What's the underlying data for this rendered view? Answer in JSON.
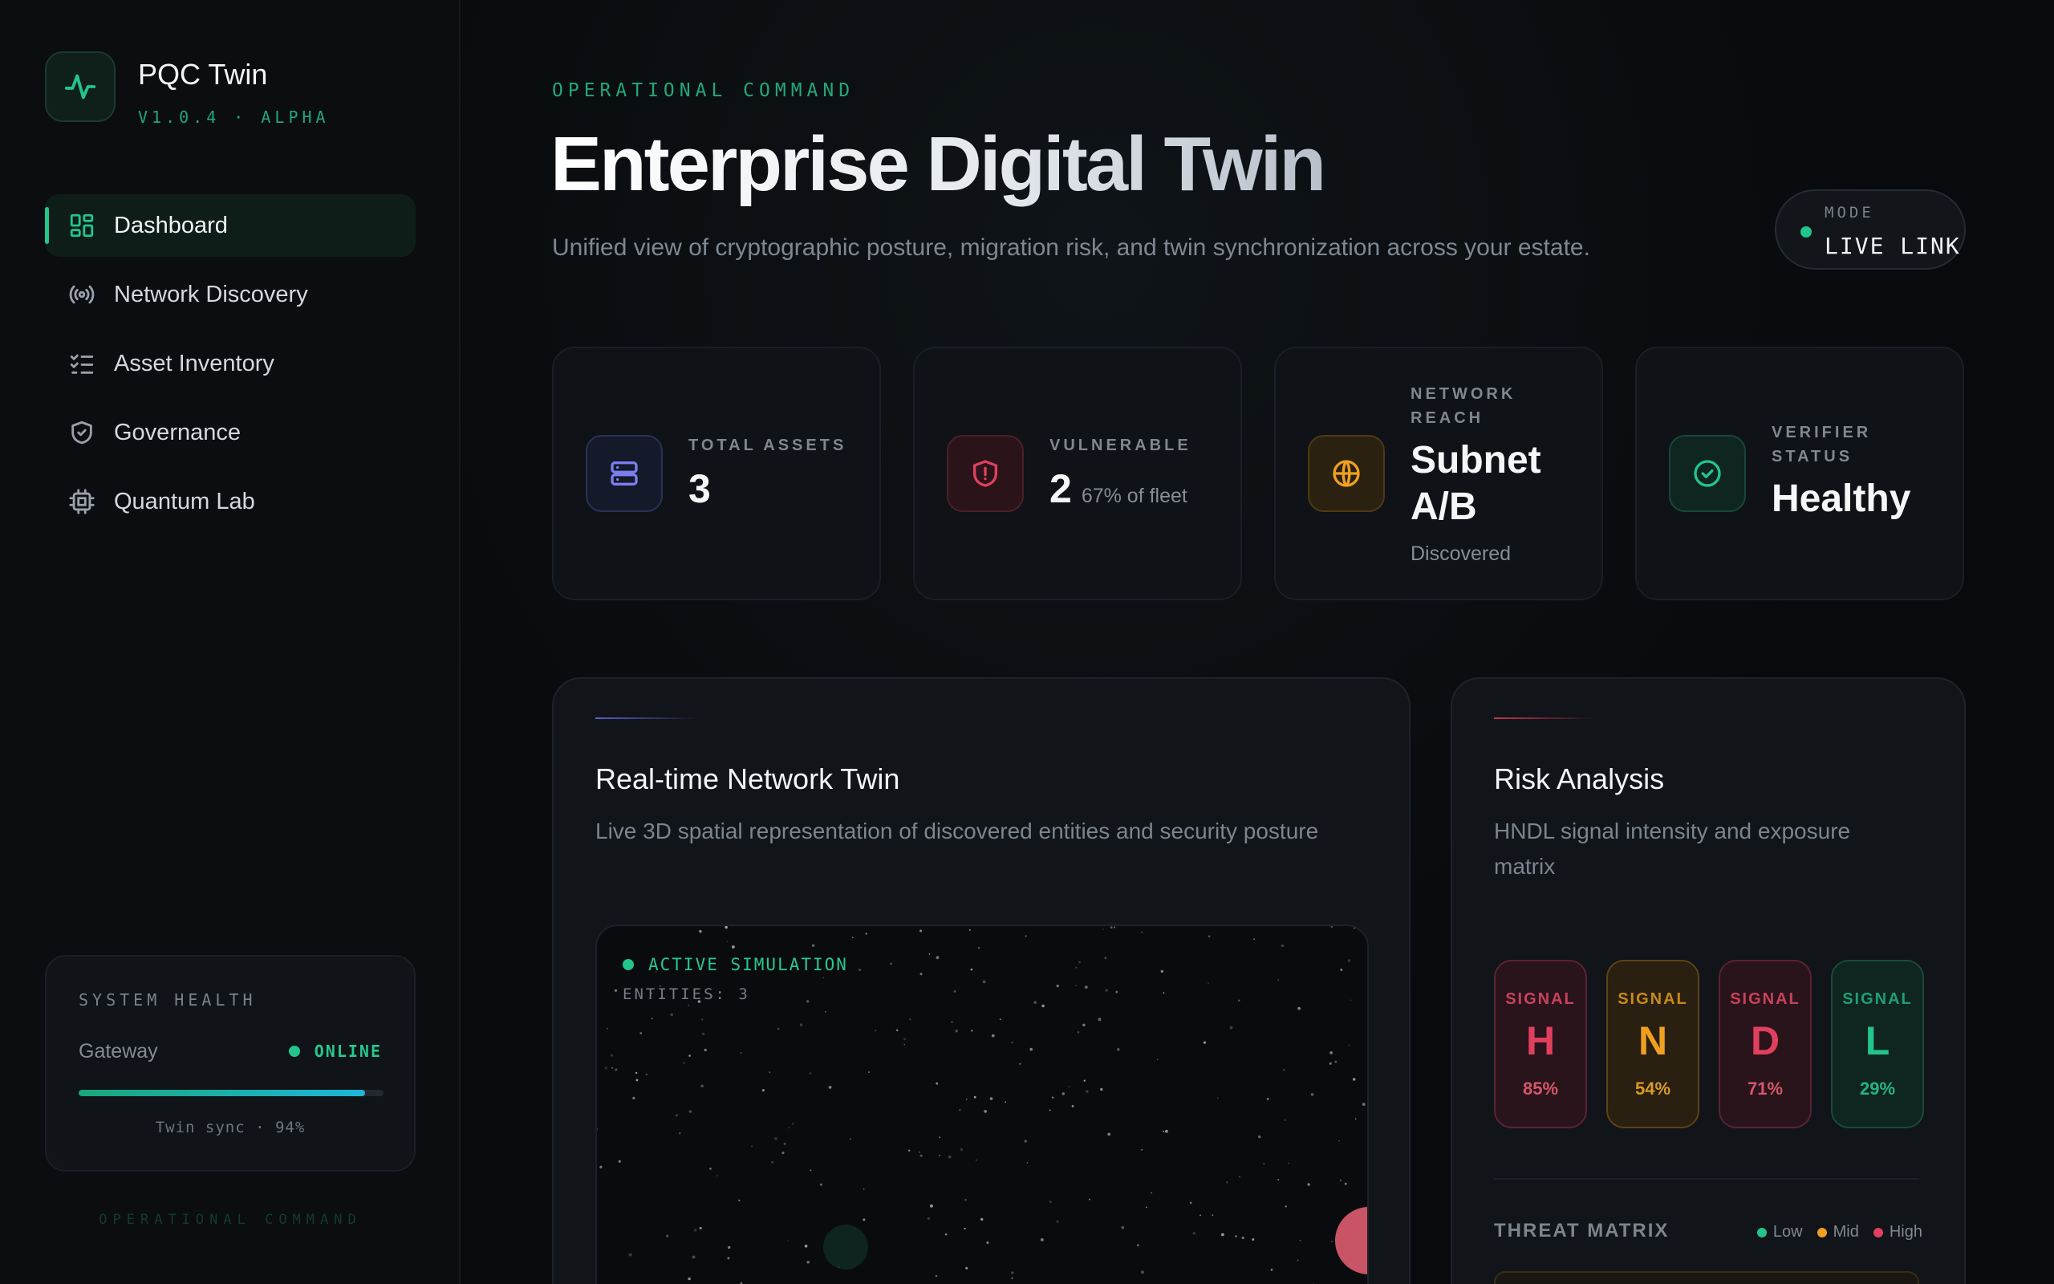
{
  "sidebar": {
    "app_title": "PQC Twin",
    "app_version": "V1.0.4 · ALPHA",
    "logo_icon": "activity-pulse-icon",
    "nav": [
      {
        "label": "Dashboard",
        "icon": "dashboard-grid-icon",
        "active": true
      },
      {
        "label": "Network Discovery",
        "icon": "broadcast-icon",
        "active": false
      },
      {
        "label": "Asset Inventory",
        "icon": "checklist-icon",
        "active": false
      },
      {
        "label": "Governance",
        "icon": "shield-check-icon",
        "active": false
      },
      {
        "label": "Quantum Lab",
        "icon": "cpu-chip-icon",
        "active": false
      }
    ],
    "health": {
      "title": "SYSTEM HEALTH",
      "label": "Gateway",
      "status": "ONLINE",
      "sync_text": "Twin sync · 94%",
      "sync_progress": 0.94
    },
    "footer": "OPERATIONAL COMMAND"
  },
  "header": {
    "eyebrow": "OPERATIONAL COMMAND",
    "title": "Enterprise Digital Twin",
    "subtitle": "Unified view of cryptographic posture, migration risk, and twin synchronization across your estate.",
    "mode_label": "MODE",
    "mode_value": "LIVE LINK"
  },
  "stats": [
    {
      "label": "TOTAL ASSETS",
      "value": "3",
      "icon": "server-icon",
      "color": "#7b7ff0"
    },
    {
      "label": "VULNERABLE",
      "value": "2",
      "note": "67% of fleet",
      "icon": "shield-alert-icon",
      "color": "#e0405e"
    },
    {
      "label_line1": "NETWORK",
      "label_line2": "REACH",
      "value_line1": "Subnet",
      "value_line2": "A/B",
      "sub": "Discovered",
      "icon": "globe-icon",
      "color": "#f0a020"
    },
    {
      "label_line1": "VERIFIER",
      "label_line2": "STATUS",
      "value": "Healthy",
      "icon": "check-circle-icon",
      "color": "#22c58b"
    }
  ],
  "twin_panel": {
    "title": "Real-time Network Twin",
    "description": "Live 3D spatial representation of discovered entities and security posture",
    "sim_status": "ACTIVE SIMULATION",
    "entities": "ENTITIES: 3"
  },
  "risk_panel": {
    "title": "Risk Analysis",
    "description_line1": "HNDL signal intensity and exposure",
    "description_line2": "matrix",
    "signals": [
      {
        "kicker": "SIGNAL",
        "letter": "H",
        "pct": "85%",
        "color": "#e0405e"
      },
      {
        "kicker": "SIGNAL",
        "letter": "N",
        "pct": "54%",
        "color": "#f0a020"
      },
      {
        "kicker": "SIGNAL",
        "letter": "D",
        "pct": "71%",
        "color": "#e0405e"
      },
      {
        "kicker": "SIGNAL",
        "letter": "L",
        "pct": "29%",
        "color": "#22c58b"
      }
    ],
    "threat_title": "THREAT MATRIX",
    "legend": [
      {
        "label": "Low",
        "color": "#22c58b"
      },
      {
        "label": "Mid",
        "color": "#f0a020"
      },
      {
        "label": "High",
        "color": "#e0405e"
      }
    ]
  },
  "colors": {
    "accent": "#22c58b",
    "danger": "#e0405e",
    "warning": "#f0a020",
    "indigo": "#7b7ff0"
  }
}
